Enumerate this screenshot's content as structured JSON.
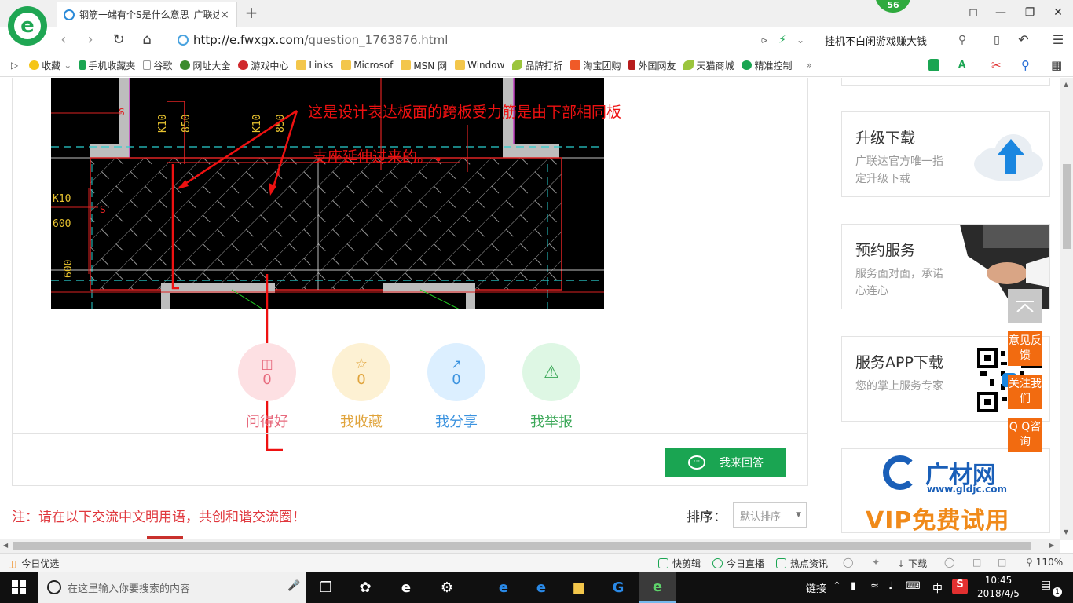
{
  "browser": {
    "tab_title": "钢筋一端有个S是什么意思_广联达",
    "tab_close": "×",
    "new_tab": "+",
    "badge": "56",
    "url_host": "http://e.fwxgx.com",
    "url_path": "/question_1763876.html",
    "promo_text": "挂机不白闲游戏赚大钱"
  },
  "bookmarks": [
    {
      "label": "收藏",
      "icon": "star-icon"
    },
    {
      "label": "手机收藏夹",
      "icon": "phone-icon"
    },
    {
      "label": "谷歌",
      "icon": "page-icon"
    },
    {
      "label": "网址大全",
      "icon": "globe-icon"
    },
    {
      "label": "游戏中心",
      "icon": "game-icon"
    },
    {
      "label": "Links",
      "icon": "folder-icon"
    },
    {
      "label": "Microsof",
      "icon": "folder-icon"
    },
    {
      "label": "MSN 网",
      "icon": "folder-icon"
    },
    {
      "label": "Window",
      "icon": "folder-icon"
    },
    {
      "label": "品牌打折",
      "icon": "leaf-icon"
    },
    {
      "label": "淘宝团购",
      "icon": "taobao-icon"
    },
    {
      "label": "外国网友",
      "icon": "flag-icon"
    },
    {
      "label": "天猫商城",
      "icon": "leaf-icon"
    },
    {
      "label": "精准控制",
      "icon": "chat-icon"
    }
  ],
  "annotation": {
    "line1": "这是设计表达板面的跨板受力筋是由下部相同板",
    "line2": "支座延伸过来的。"
  },
  "cad_labels": {
    "k10a": "K10",
    "v850a": "850",
    "k10b": "K10",
    "v850b": "850",
    "k10c": "K10",
    "v600a": "600",
    "v600b": "600",
    "s1": "S",
    "s2": "S"
  },
  "actions": [
    {
      "count": "0",
      "label": "问得好",
      "icon": "gift-icon",
      "bg": "#fde0e3",
      "fg": "#e76a7d"
    },
    {
      "count": "0",
      "label": "我收藏",
      "icon": "star-icon",
      "bg": "#fdf1d3",
      "fg": "#e0a33a"
    },
    {
      "count": "0",
      "label": "我分享",
      "icon": "share-icon",
      "bg": "#dcefff",
      "fg": "#3a92df"
    },
    {
      "count": "",
      "label": "我举报",
      "icon": "warning-icon",
      "bg": "#def7e4",
      "fg": "#3aa757"
    }
  ],
  "answer_button": "我来回答",
  "note": "注：请在以下交流中文明用语，共创和谐交流圈！",
  "sort": {
    "label": "排序：",
    "value": "默认排序"
  },
  "cards": [
    {
      "title": "升级下载",
      "desc": "广联达官方唯一指定升级下载"
    },
    {
      "title": "预约服务",
      "desc": "服务面对面，承诺心连心"
    },
    {
      "title": "服务APP下载",
      "desc": "您的掌上服务专家"
    }
  ],
  "ad": {
    "brand": "广材网",
    "site": "www.gldjc.com",
    "slogan": "VIP免费试用"
  },
  "side_buttons": [
    "意见反馈",
    "关注我们",
    "Q Q咨询"
  ],
  "statusbar": {
    "left": "今日优选",
    "items": [
      "快剪辑",
      "今日直播",
      "热点资讯",
      "下载"
    ],
    "zoom": "110%"
  },
  "taskbar": {
    "search_placeholder": "在这里输入你要搜索的内容",
    "link_label": "链接",
    "ime": "中",
    "time": "10:45",
    "date": "2018/4/5",
    "notifications": "1"
  }
}
